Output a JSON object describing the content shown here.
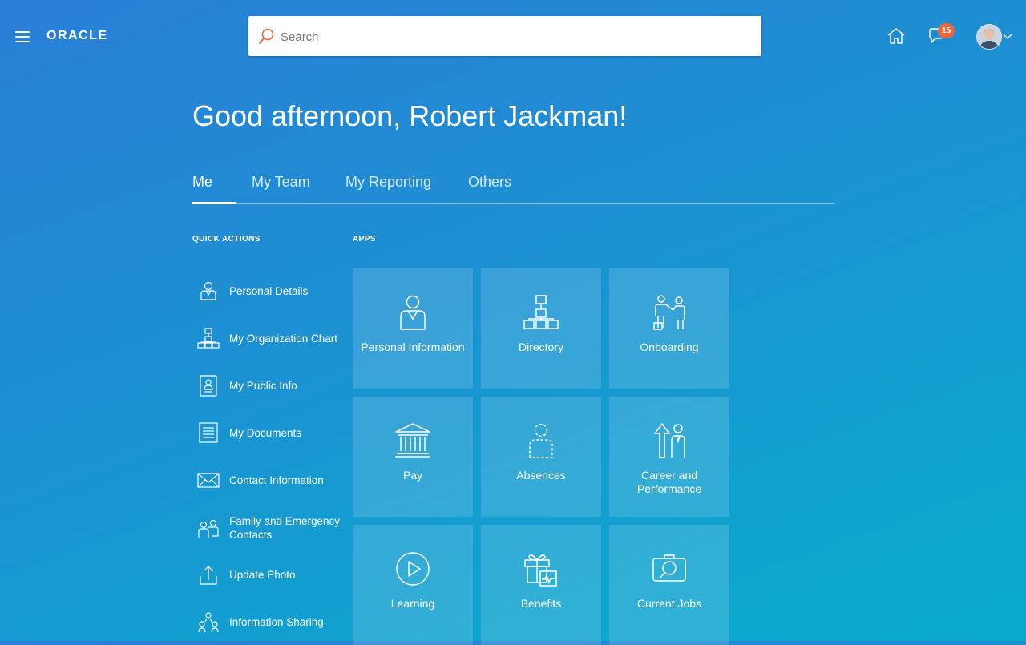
{
  "header": {
    "logo_text": "ORACLE",
    "search_placeholder": "Search",
    "notification_count": "15",
    "accent_color": "#f0643a"
  },
  "greeting": "Good afternoon, Robert Jackman!",
  "tabs": [
    {
      "label": "Me",
      "active": true
    },
    {
      "label": "My Team",
      "active": false
    },
    {
      "label": "My Reporting",
      "active": false
    },
    {
      "label": "Others",
      "active": false
    }
  ],
  "quick_actions": {
    "title": "QUICK ACTIONS",
    "items": [
      {
        "label": "Personal Details",
        "icon": "person-badge-icon"
      },
      {
        "label": "My Organization Chart",
        "icon": "org-chart-icon"
      },
      {
        "label": "My Public Info",
        "icon": "id-card-icon"
      },
      {
        "label": "My Documents",
        "icon": "document-icon"
      },
      {
        "label": "Contact Information",
        "icon": "envelope-icon"
      },
      {
        "label": "Family and Emergency Contacts",
        "icon": "family-icon"
      },
      {
        "label": "Update Photo",
        "icon": "upload-icon"
      },
      {
        "label": "Information Sharing",
        "icon": "sharing-icon"
      }
    ]
  },
  "apps": {
    "title": "APPS",
    "items": [
      {
        "label": "Personal Information",
        "icon": "person-icon"
      },
      {
        "label": "Directory",
        "icon": "directory-icon"
      },
      {
        "label": "Onboarding",
        "icon": "onboarding-icon"
      },
      {
        "label": "Pay",
        "icon": "bank-icon"
      },
      {
        "label": "Absences",
        "icon": "absent-person-icon"
      },
      {
        "label": "Career and Performance",
        "icon": "career-icon"
      },
      {
        "label": "Learning",
        "icon": "play-icon"
      },
      {
        "label": "Benefits",
        "icon": "gift-icon"
      },
      {
        "label": "Current Jobs",
        "icon": "job-search-icon"
      }
    ]
  }
}
